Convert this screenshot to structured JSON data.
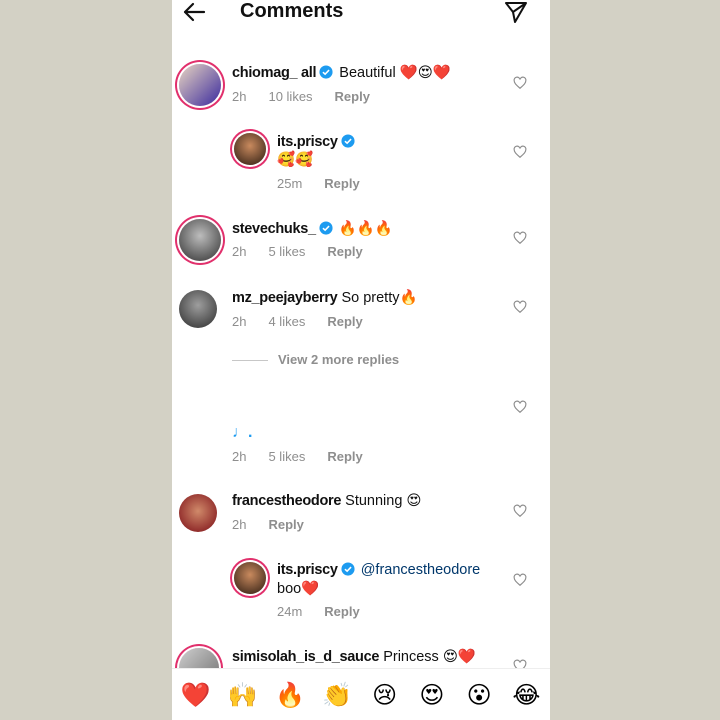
{
  "header": {
    "title": "Comments"
  },
  "comments": [
    {
      "user": "chiomag_     all",
      "text": "Beautiful ❤️😍❤️",
      "time": "2h",
      "likes": "10 likes",
      "reply": "Reply"
    },
    {
      "user": "its.priscy",
      "text": "",
      "text2": "🥰🥰",
      "time": "25m",
      "reply": "Reply"
    },
    {
      "user": "stevechuks_",
      "text": "🔥🔥🔥",
      "time": "2h",
      "likes": "5 likes",
      "reply": "Reply"
    },
    {
      "user": "mz_peejayberry",
      "text": "So pretty🔥",
      "time": "2h",
      "likes": "4 likes",
      "reply": "Reply"
    },
    {
      "text2": "♩.",
      "time": "2h",
      "likes": "5 likes",
      "reply": "Reply"
    },
    {
      "user": "francestheodore",
      "text": "Stunning 😍",
      "time": "2h",
      "reply": "Reply"
    },
    {
      "user": "its.priscy",
      "mention": "@francestheodore",
      "text2": "boo❤️",
      "time": "24m",
      "reply": "Reply"
    },
    {
      "user": "simisolah_is_d_sauce",
      "text": "Princess 😍❤️"
    }
  ],
  "view_replies": "View 2 more replies",
  "emoji_bar": [
    "❤️",
    "🙌",
    "🔥",
    "👏",
    "😢",
    "😍",
    "😮",
    "😂"
  ],
  "colors": {
    "verified": "#1d9bf0",
    "muted": "#8e8e8e",
    "mention": "#00376b"
  }
}
